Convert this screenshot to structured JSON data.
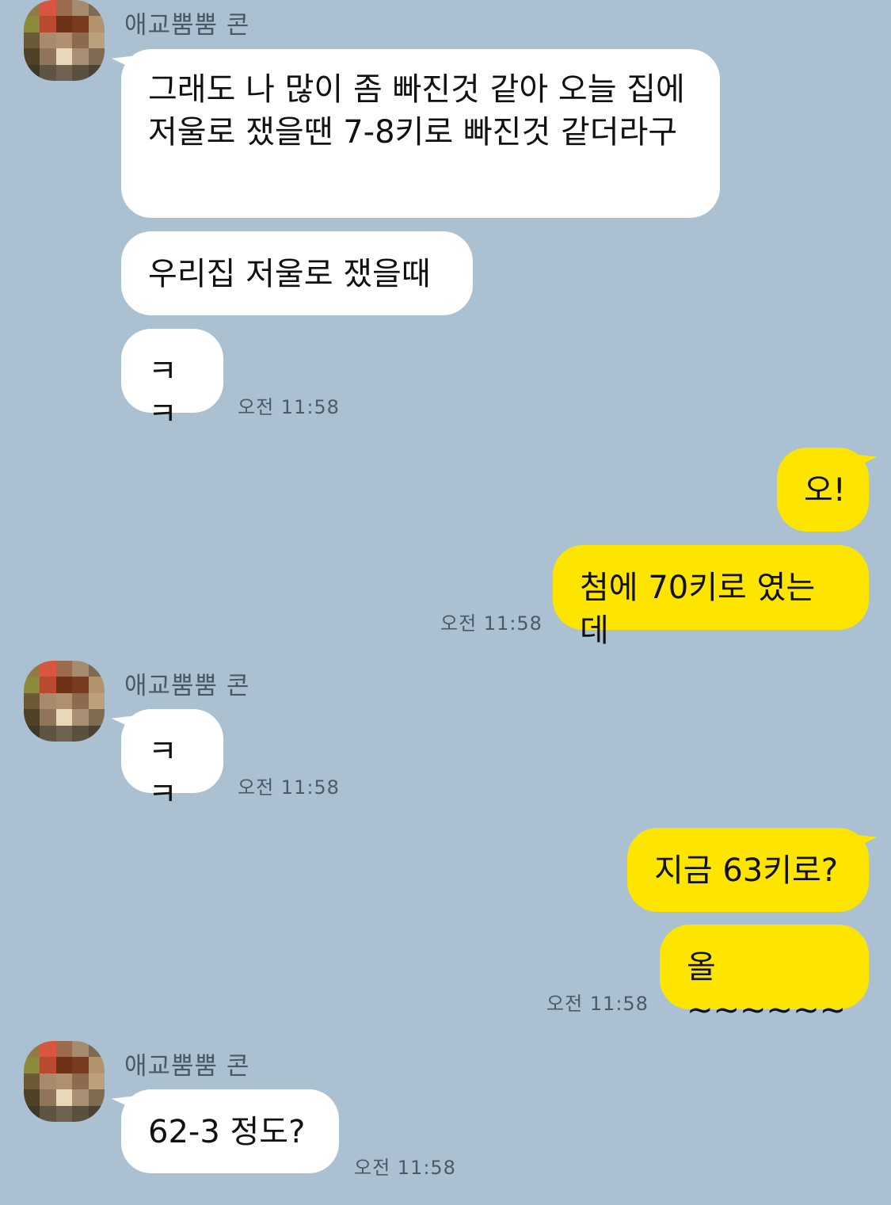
{
  "contact": {
    "name": "애교뿜뿜 콘"
  },
  "colors": {
    "background": "#abc1d1",
    "incoming_bubble": "#ffffff",
    "outgoing_bubble": "#fee500"
  },
  "messages": [
    {
      "sender": "contact",
      "text": "그래도 나 많이 좀 빠진것 같아 오늘 집에 저울로 쟀을땐 7-8키로 빠진것 같더라구"
    },
    {
      "sender": "contact",
      "text": "우리집 저울로 쟀을때"
    },
    {
      "sender": "contact",
      "text": "ㅋㅋ",
      "time": "오전 11:58"
    },
    {
      "sender": "me",
      "text": "오!"
    },
    {
      "sender": "me",
      "text": "첨에 70키로 였는데",
      "time": "오전 11:58"
    },
    {
      "sender": "contact",
      "text": "ㅋㅋ",
      "time": "오전 11:58"
    },
    {
      "sender": "me",
      "text": "지금 63키로?"
    },
    {
      "sender": "me",
      "text": "올~~~~~~",
      "time": "오전 11:58"
    },
    {
      "sender": "contact",
      "text": "62-3 정도?",
      "time": "오전 11:58"
    }
  ]
}
